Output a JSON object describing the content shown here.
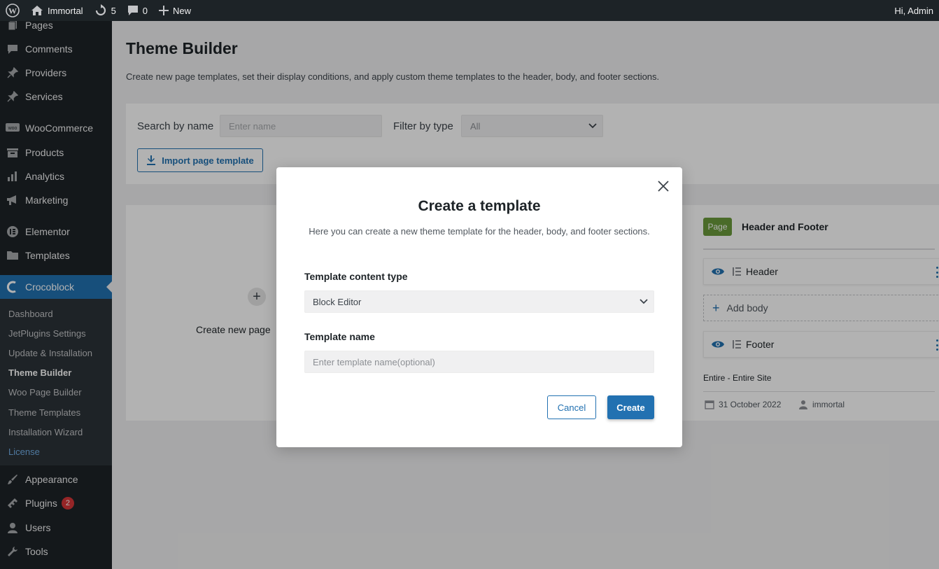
{
  "admin_bar": {
    "site_name": "Immortal",
    "updates_count": "5",
    "comments_count": "0",
    "new_label": "New",
    "greeting": "Hi, Admin"
  },
  "sidebar": {
    "items": [
      {
        "label": "Pages",
        "icon": "pages-icon"
      },
      {
        "label": "Comments",
        "icon": "comments-icon"
      },
      {
        "label": "Providers",
        "icon": "pin-icon"
      },
      {
        "label": "Services",
        "icon": "pin-icon"
      },
      {
        "label": "WooCommerce",
        "icon": "woo-icon"
      },
      {
        "label": "Products",
        "icon": "products-icon"
      },
      {
        "label": "Analytics",
        "icon": "bar-chart-icon"
      },
      {
        "label": "Marketing",
        "icon": "megaphone-icon"
      },
      {
        "label": "Elementor",
        "icon": "elementor-icon"
      },
      {
        "label": "Templates",
        "icon": "folder-icon"
      },
      {
        "label": "Crocoblock",
        "icon": "crocoblock-icon"
      }
    ],
    "submenu": [
      {
        "label": "Dashboard"
      },
      {
        "label": "JetPlugins Settings"
      },
      {
        "label": "Update & Installation"
      },
      {
        "label": "Theme Builder"
      },
      {
        "label": "Woo Page Builder"
      },
      {
        "label": "Theme Templates"
      },
      {
        "label": "Installation Wizard"
      },
      {
        "label": "License"
      }
    ],
    "bottom_items": [
      {
        "label": "Appearance",
        "icon": "brush-icon"
      },
      {
        "label": "Plugins",
        "icon": "plugin-icon",
        "badge": "2"
      },
      {
        "label": "Users",
        "icon": "user-icon"
      },
      {
        "label": "Tools",
        "icon": "wrench-icon"
      }
    ]
  },
  "main": {
    "title": "Theme Builder",
    "description": "Create new page templates, set their display conditions, and apply custom theme templates to the header, body, and footer sections.",
    "filters": {
      "search_label": "Search by name",
      "search_placeholder": "Enter name",
      "type_label": "Filter by type",
      "type_value": "All",
      "import_label": "Import page template"
    },
    "create_card_label": "Create new page",
    "template_card": {
      "badge": "Page",
      "title": "Header and Footer",
      "header_label": "Header",
      "add_body_label": "Add body",
      "footer_label": "Footer",
      "condition": "Entire - Entire Site",
      "date": "31 October 2022",
      "author": "immortal"
    }
  },
  "modal": {
    "title": "Create a template",
    "description": "Here you can create a new theme template for the header, body, and footer sections.",
    "content_type_label": "Template content type",
    "content_type_value": "Block Editor",
    "name_label": "Template name",
    "name_placeholder": "Enter template name(optional)",
    "cancel_label": "Cancel",
    "create_label": "Create"
  },
  "colors": {
    "accent": "#2271b1",
    "admin_bg": "#1d2327",
    "page_badge": "#6a9a3b"
  }
}
